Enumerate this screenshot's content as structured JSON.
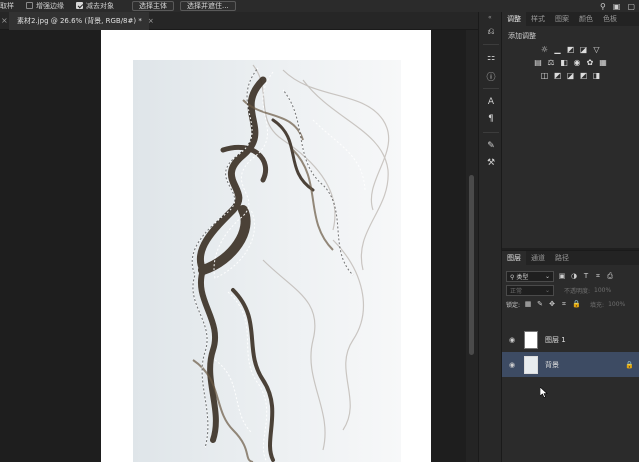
{
  "options_bar": {
    "left_cut_label": "取样",
    "enhance_edge_label": "增强边缘",
    "subtract_object_label": "减去对象",
    "select_subject_label": "选择主体",
    "select_mask_label": "选择并遮住..."
  },
  "doc_tab": {
    "title": "素材2.jpg @ 26.6% (背景, RGB/8#) *",
    "close": "×"
  },
  "adjustments_panel": {
    "tabs": [
      "调整",
      "样式",
      "图案",
      "颜色",
      "色板"
    ],
    "active_tab": "调整",
    "title": "添加调整",
    "icons_row1": [
      "brightness-icon",
      "levels-icon",
      "curves-icon",
      "exposure-icon",
      "vibrance-icon"
    ],
    "icons_row2": [
      "hue-saturation-icon",
      "color-balance-icon",
      "black-white-icon",
      "photo-filter-icon",
      "channel-mixer-icon",
      "color-lookup-icon"
    ],
    "icons_row3": [
      "invert-icon",
      "posterize-icon",
      "threshold-icon",
      "selective-color-icon",
      "gradient-map-icon"
    ]
  },
  "layers_panel": {
    "tabs": [
      "图层",
      "通道",
      "路径"
    ],
    "active_tab": "图层",
    "filter_label": "类型",
    "blend_mode": "正常",
    "opacity_label": "不透明度:",
    "opacity_value": "100%",
    "lock_label": "锁定:",
    "fill_label": "填充:",
    "fill_value": "100%",
    "layers": [
      {
        "name": "图层 1",
        "active": false
      },
      {
        "name": "背景",
        "active": true
      }
    ]
  },
  "colors": {
    "selection_bg": "#3d4b63",
    "panel_bg": "#2b2b2b",
    "canvas_bg": "#1e1e1e"
  }
}
